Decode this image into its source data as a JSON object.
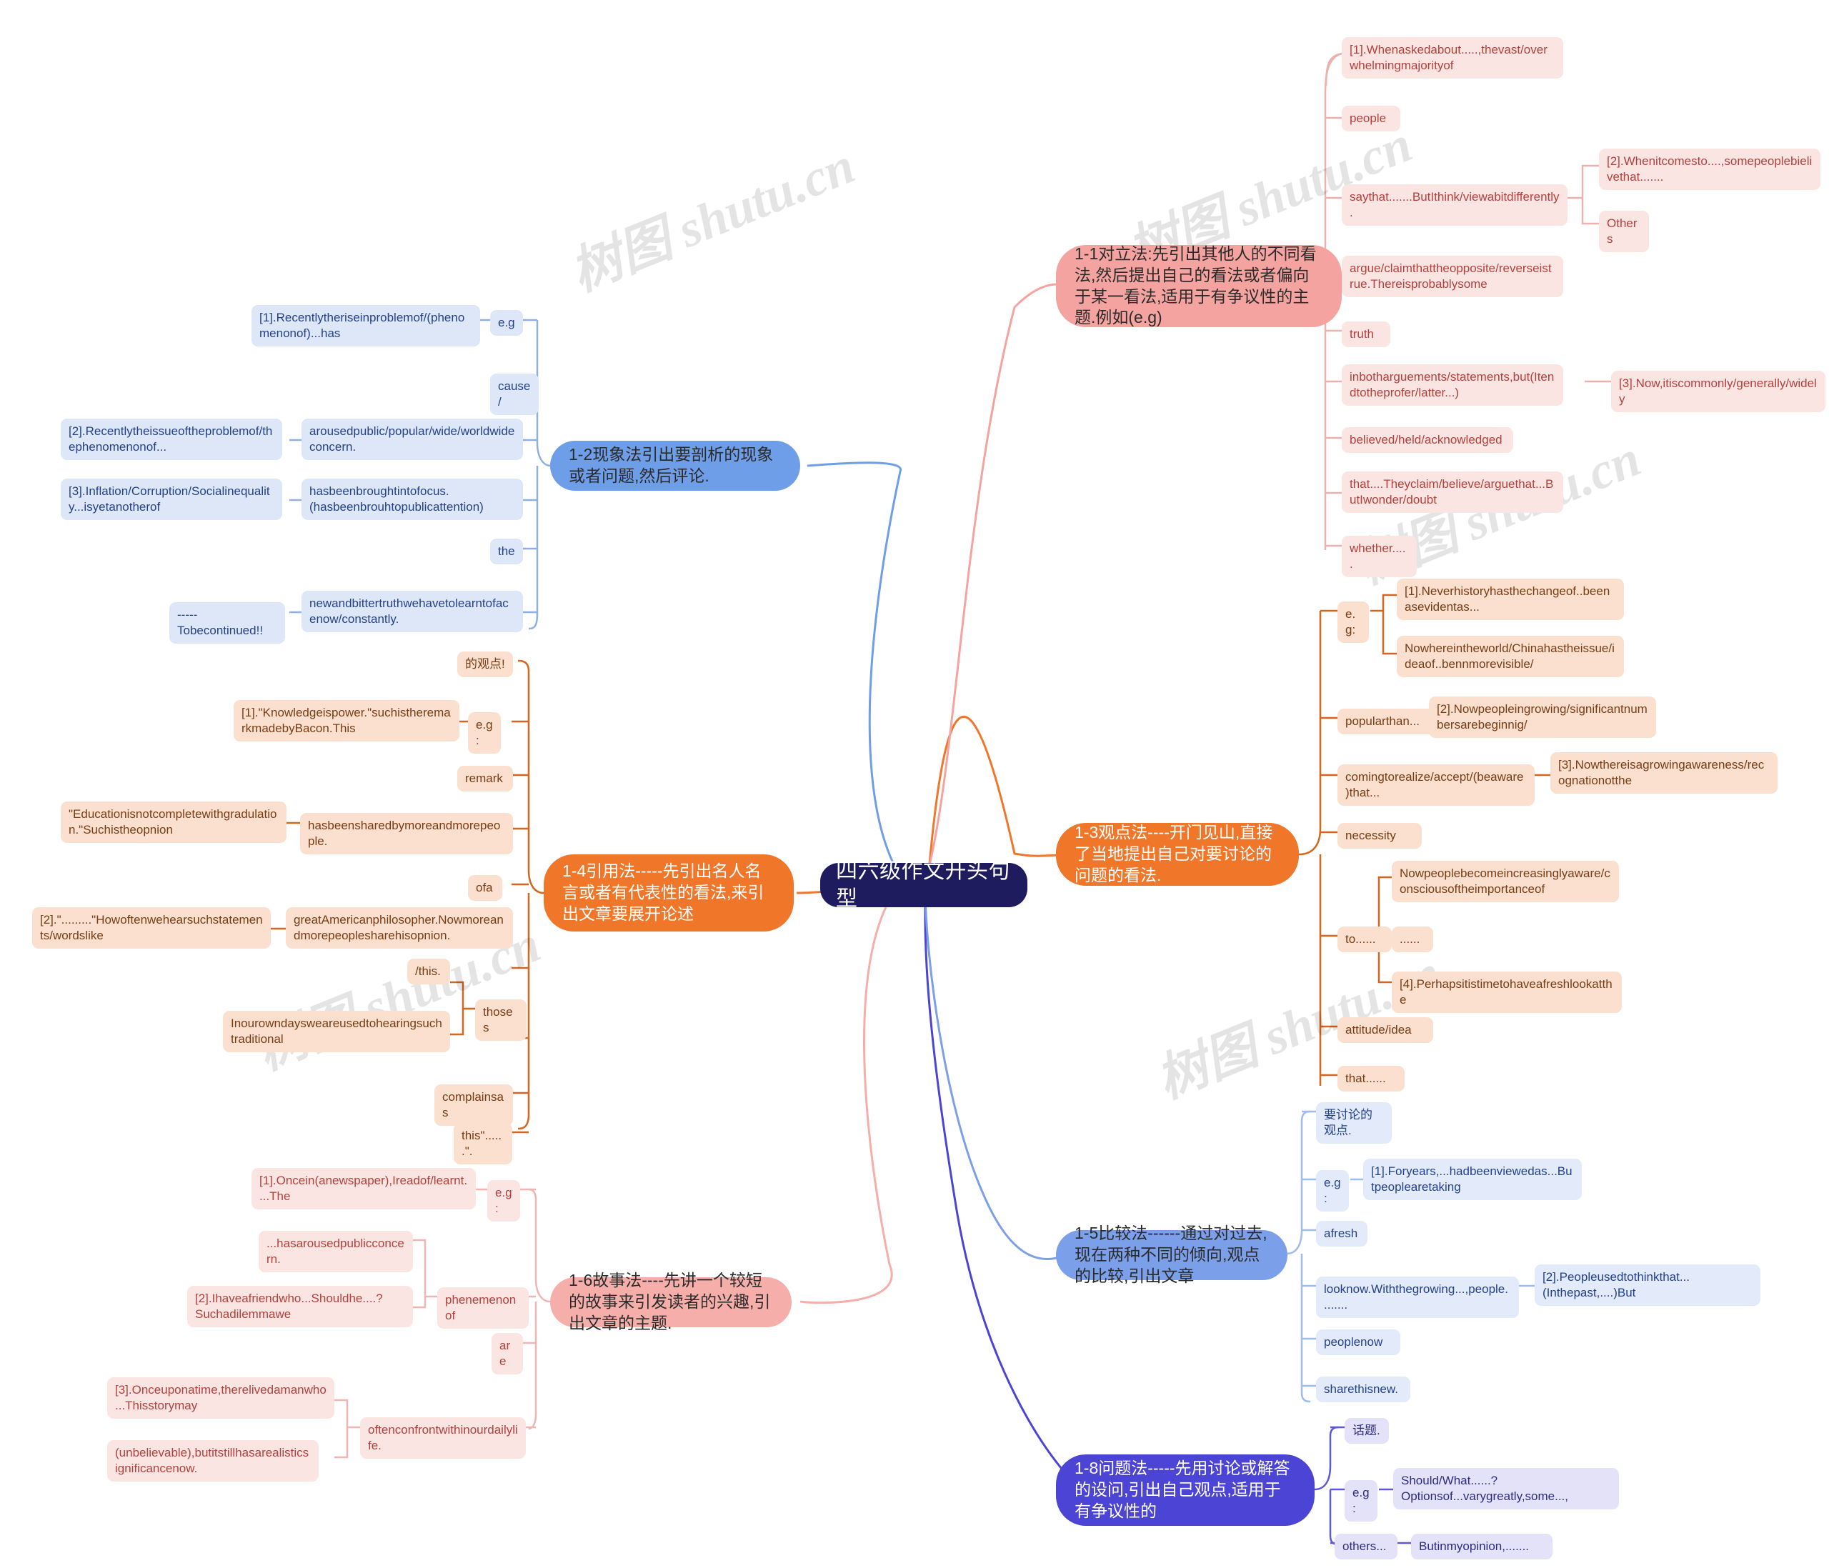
{
  "root": {
    "label": "四六级作文开头句型"
  },
  "watermarks": [
    "树图 shutu.cn",
    "树图 shutu.cn",
    "树图 shutu.cn",
    "树图 shutu.cn",
    "树图 shutu.cn"
  ],
  "colors": {
    "root_bg": "#1e1b5e",
    "pink": "#f4a3a0",
    "blue": "#6f9ee8",
    "orange": "#f0762a",
    "light_pink": "#f6aeab",
    "light_blue": "#7b9fe8",
    "purple": "#4c44d4",
    "chip_pink": "#fbe5e2",
    "chip_blue": "#dde7f8",
    "chip_orange": "#fbe0cf",
    "chip_lblue": "#e3ebfa",
    "chip_purple": "#e3e2f8"
  },
  "branches": {
    "b11": {
      "topic": "1-1对立法:先引出其他人的不同看法,然后提出自己的看法或者偏向于某一看法,适用于有争议性的主题.例如(e.g)",
      "nodes": {
        "n1": "[1].Whenaskedabout.....,thevast/overwhelmingmajorityof",
        "n2": "people",
        "n3": "saythat.......ButIthink/viewabitdifferently.",
        "n3a": "[2].Whenitcomesto....,somepeoplebielivethat.......",
        "n3b": "Others",
        "n4": "argue/claimthattheopposite/reverseistrue.Thereisprobablysome",
        "n5": "truth",
        "n6": "inbotharguements/statements,but(Itendtotheprofer/latter...)",
        "n6a": "[3].Now,itiscommonly/generally/widely",
        "n7": "believed/held/acknowledged",
        "n8": "that....Theyclaim/believe/arguethat...ButIwonder/doubt",
        "n9": "whether....."
      }
    },
    "b12": {
      "topic": "1-2现象法引出要剖析的现象或者问题,然后评论.",
      "nodes": {
        "n1": "e.g",
        "n1a": "[1].Recentlytheriseinproblemof/(phenomenonof)...has",
        "n2": "cause/",
        "n3": "arousedpublic/popular/wide/worldwideconcern.",
        "n3a": "[2].Recentlytheissueoftheproblemof/thephenomenonof...",
        "n4": "hasbeenbroughtintofocus.(hasbeenbrouhtopublicattention)",
        "n4a": "[3].Inflation/Corruption/Socialinequality...isyetanotherof",
        "n5": "the",
        "n6": "newandbittertruthwehavetolearntofacenow/constantly.",
        "n6a": "-----Tobecontinued!!"
      }
    },
    "b13": {
      "topic": "1-3观点法----开门见山,直接了当地提出自己对要讨论的问题的看法.",
      "nodes": {
        "n1": "e.g:",
        "n1a": "[1].Neverhistoryhasthechangeof..beenasevidentas...",
        "n1b": "Nowhereintheworld/Chinahastheissue/ideaof..bennmorevisible/",
        "n2": "popularthan...",
        "n2a": "[2].Nowpeopleingrowing/significantnumbersarebeginnig/",
        "n3": "comingtorealize/accept/(beaware)that...",
        "n3a": "[3].Nowthereisagrowingawareness/recognationotthe",
        "n4": "necessity",
        "n5": "to......",
        "n5a": "Nowpeoplebecomeincreasinglyaware/consciousoftheimportanceof",
        "n5b": "......",
        "n5c": "[4].Perhapsitistimetohaveafreshlookatthe",
        "n6": "attitude/idea",
        "n7": "that......"
      }
    },
    "b14": {
      "topic": "1-4引用法-----先引出名人名言或者有代表性的看法,来引出文章要展开论述",
      "nodes": {
        "n1": "的观点!",
        "n2": "e.g:",
        "n2a": "[1].\"Knowledgeispower.\"suchistheremarkmadebyBacon.This",
        "n3": "remark",
        "n4": "hasbeensharedbymoreandmorepeople.",
        "n4a": "\"Educationisnotcompletewithgradulation.\"Suchistheopnion",
        "n5": "ofa",
        "n6": "greatAmericanphilosopher.Nowmoreandmorepeoplesharehisopnion.",
        "n6a": "[2].\".........\"Howoftenwehearsuchstatements/wordslike",
        "n7": "/this.",
        "n8": "thoses",
        "n8a": "Inourowndaysweareusedtohearingsuchtraditional",
        "n9": "complainsas",
        "n10": "this\"......\"."
      }
    },
    "b15": {
      "topic": "1-5比较法------通过对过去,现在两种不同的倾向,观点的比较,引出文章",
      "nodes": {
        "n1": "要讨论的观点.",
        "n2": "e.g:",
        "n2a": "[1].Foryears,...hadbeenviewedas...Butpeoplearetaking",
        "n3": "afresh",
        "n4": "looknow.Withthegrowing...,people........",
        "n4a": "[2].Peopleusedtothinkthat...(Inthepast,....)But",
        "n5": "peoplenow",
        "n6": "sharethisnew."
      }
    },
    "b16": {
      "topic": "1-6故事法----先讲一个较短的故事来引发读者的兴趣,引出文章的主题.",
      "nodes": {
        "n1": "e.g:",
        "n1a": "[1].Oncein(anewspaper),Ireadof/learnt....The",
        "n2": "phenemenonof",
        "n2a": "...hasarousedpublicconcern.",
        "n2b": "[2].Ihaveafriendwho...Shouldhe....?Suchadilemmawe",
        "n3": "are",
        "n4": "oftenconfrontwithinourdailylife.",
        "n4a": "[3].Onceuponatime,therelivedamanwho...Thisstorymay",
        "n4b": "(unbelievable),butitstillhasarealisticsignificancenow."
      }
    },
    "b18": {
      "topic": "1-8问题法-----先用讨论或解答的设问,引出自己观点,适用于有争议性的",
      "nodes": {
        "n1": "话题.",
        "n2": "e.g:",
        "n2a": "Should/What......?Optionsof...varygreatly,some...,",
        "n3": "others...",
        "n3a": "Butinmyopinion,......."
      }
    }
  }
}
